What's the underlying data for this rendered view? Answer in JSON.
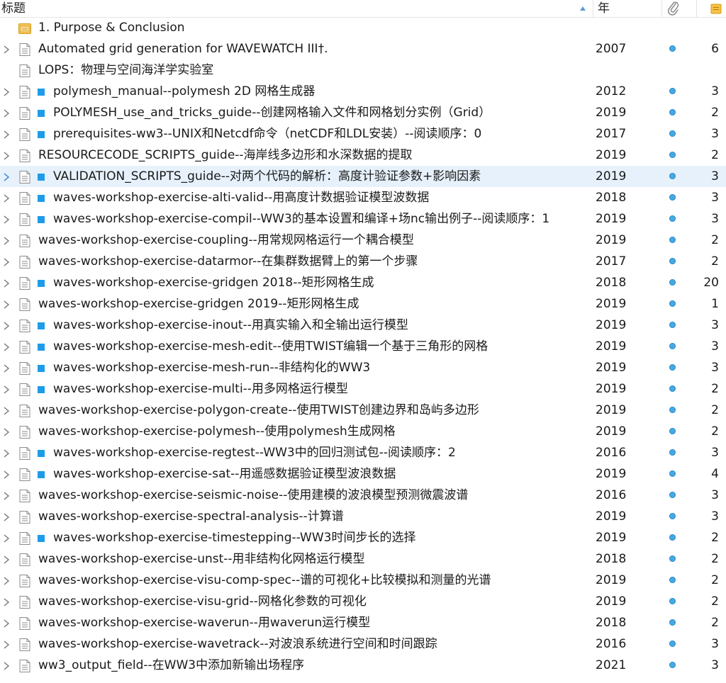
{
  "columns": {
    "title": "标题",
    "year": "年",
    "attachment_icon": "paperclip-icon",
    "notes_icon": "note-icon"
  },
  "sort_indicator": "ascending",
  "rows": [
    {
      "title": "1. Purpose & Conclusion",
      "year": "",
      "count": "",
      "icon": "folder-note",
      "has_children": false,
      "has_attachment": false,
      "has_square": false
    },
    {
      "title": "Automated grid generation for WAVEWATCH III†.",
      "year": "2007",
      "count": "6",
      "icon": "document",
      "has_children": true,
      "has_attachment": true,
      "has_square": false
    },
    {
      "title": "LOPS：物理与空间海洋学实验室",
      "year": "",
      "count": "",
      "icon": "document",
      "has_children": false,
      "has_attachment": false,
      "has_square": false
    },
    {
      "title": "polymesh_manual--polymesh 2D 网格生成器",
      "year": "2012",
      "count": "3",
      "icon": "document",
      "has_children": true,
      "has_attachment": true,
      "has_square": true
    },
    {
      "title": "POLYMESH_use_and_tricks_guide--创建网格输入文件和网格划分实例（Grid）",
      "year": "2019",
      "count": "2",
      "icon": "document",
      "has_children": true,
      "has_attachment": true,
      "has_square": true
    },
    {
      "title": "prerequisites-ww3--UNIX和Netcdf命令（netCDF和LDL安装）--阅读顺序：0",
      "year": "2017",
      "count": "3",
      "icon": "document",
      "has_children": true,
      "has_attachment": true,
      "has_square": true
    },
    {
      "title": "RESOURCECODE_SCRIPTS_guide--海岸线多边形和水深数据的提取",
      "year": "2019",
      "count": "2",
      "icon": "document",
      "has_children": true,
      "has_attachment": true,
      "has_square": false
    },
    {
      "title": "VALIDATION_SCRIPTS_guide--对两个代码的解析：高度计验证参数+影响因素",
      "year": "2019",
      "count": "3",
      "icon": "document",
      "has_children": true,
      "has_attachment": true,
      "has_square": true,
      "selected": true
    },
    {
      "title": "waves-workshop-exercise-alti-valid--用高度计数据验证模型波数据",
      "year": "2018",
      "count": "3",
      "icon": "document",
      "has_children": true,
      "has_attachment": true,
      "has_square": true
    },
    {
      "title": "waves-workshop-exercise-compil--WW3的基本设置和编译+场nc输出例子--阅读顺序：1",
      "year": "2019",
      "count": "3",
      "icon": "document",
      "has_children": true,
      "has_attachment": true,
      "has_square": true
    },
    {
      "title": "waves-workshop-exercise-coupling--用常规网格运行一个耦合模型",
      "year": "2019",
      "count": "2",
      "icon": "document",
      "has_children": true,
      "has_attachment": true,
      "has_square": false
    },
    {
      "title": "waves-workshop-exercise-datarmor--在集群数据臂上的第一个步骤",
      "year": "2017",
      "count": "2",
      "icon": "document",
      "has_children": true,
      "has_attachment": true,
      "has_square": false
    },
    {
      "title": "waves-workshop-exercise-gridgen 2018--矩形网格生成",
      "year": "2018",
      "count": "20",
      "icon": "document",
      "has_children": true,
      "has_attachment": true,
      "has_square": true
    },
    {
      "title": "waves-workshop-exercise-gridgen 2019--矩形网格生成",
      "year": "2019",
      "count": "1",
      "icon": "document",
      "has_children": true,
      "has_attachment": true,
      "has_square": false
    },
    {
      "title": "waves-workshop-exercise-inout--用真实输入和全输出运行模型",
      "year": "2019",
      "count": "3",
      "icon": "document",
      "has_children": true,
      "has_attachment": true,
      "has_square": true
    },
    {
      "title": "waves-workshop-exercise-mesh-edit--使用TWIST编辑一个基于三角形的网格",
      "year": "2019",
      "count": "3",
      "icon": "document",
      "has_children": true,
      "has_attachment": true,
      "has_square": true
    },
    {
      "title": "waves-workshop-exercise-mesh-run--非结构化的WW3",
      "year": "2019",
      "count": "3",
      "icon": "document",
      "has_children": true,
      "has_attachment": true,
      "has_square": true
    },
    {
      "title": "waves-workshop-exercise-multi--用多网格运行模型",
      "year": "2019",
      "count": "2",
      "icon": "document",
      "has_children": true,
      "has_attachment": true,
      "has_square": true
    },
    {
      "title": "waves-workshop-exercise-polygon-create--使用TWIST创建边界和岛屿多边形",
      "year": "2019",
      "count": "2",
      "icon": "document",
      "has_children": true,
      "has_attachment": true,
      "has_square": false
    },
    {
      "title": "waves-workshop-exercise-polymesh--使用polymesh生成网格",
      "year": "2019",
      "count": "2",
      "icon": "document",
      "has_children": true,
      "has_attachment": true,
      "has_square": false
    },
    {
      "title": "waves-workshop-exercise-regtest--WW3中的回归测试包--阅读顺序：2",
      "year": "2016",
      "count": "3",
      "icon": "document",
      "has_children": true,
      "has_attachment": true,
      "has_square": true
    },
    {
      "title": "waves-workshop-exercise-sat--用遥感数据验证模型波浪数据",
      "year": "2019",
      "count": "4",
      "icon": "document",
      "has_children": true,
      "has_attachment": true,
      "has_square": true
    },
    {
      "title": "waves-workshop-exercise-seismic-noise--使用建模的波浪模型预测微震波谱",
      "year": "2016",
      "count": "3",
      "icon": "document",
      "has_children": true,
      "has_attachment": true,
      "has_square": false
    },
    {
      "title": "waves-workshop-exercise-spectral-analysis--计算谱",
      "year": "2019",
      "count": "3",
      "icon": "document",
      "has_children": true,
      "has_attachment": true,
      "has_square": false
    },
    {
      "title": "waves-workshop-exercise-timestepping--WW3时间步长的选择",
      "year": "2019",
      "count": "2",
      "icon": "document",
      "has_children": true,
      "has_attachment": true,
      "has_square": true
    },
    {
      "title": "waves-workshop-exercise-unst--用非结构化网格运行模型",
      "year": "2018",
      "count": "2",
      "icon": "document",
      "has_children": true,
      "has_attachment": true,
      "has_square": false
    },
    {
      "title": "waves-workshop-exercise-visu-comp-spec--谱的可视化+比较模拟和测量的光谱",
      "year": "2019",
      "count": "2",
      "icon": "document",
      "has_children": true,
      "has_attachment": true,
      "has_square": false
    },
    {
      "title": "waves-workshop-exercise-visu-grid--网格化参数的可视化",
      "year": "2019",
      "count": "2",
      "icon": "document",
      "has_children": true,
      "has_attachment": true,
      "has_square": false
    },
    {
      "title": "waves-workshop-exercise-waverun--用waverun运行模型",
      "year": "2018",
      "count": "2",
      "icon": "document",
      "has_children": true,
      "has_attachment": true,
      "has_square": false
    },
    {
      "title": "waves-workshop-exercise-wavetrack--对波浪系统进行空间和时间跟踪",
      "year": "2016",
      "count": "3",
      "icon": "document",
      "has_children": true,
      "has_attachment": true,
      "has_square": false
    },
    {
      "title": "ww3_output_field--在WW3中添加新输出场程序",
      "year": "2021",
      "count": "3",
      "icon": "document",
      "has_children": true,
      "has_attachment": true,
      "has_square": false
    }
  ]
}
